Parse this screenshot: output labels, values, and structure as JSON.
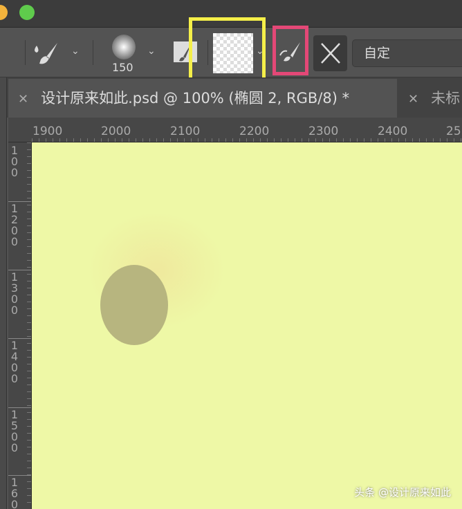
{
  "window": {
    "traffic_lights": [
      "#f3b33c",
      "#5fcb4c"
    ]
  },
  "options_bar": {
    "brush_size": "150",
    "preset_dropdown": "自定"
  },
  "tabs": [
    {
      "label": "设计原来如此.psd @ 100% (椭圆 2, RGB/8) *",
      "active": true
    },
    {
      "label": "未标",
      "active": false
    }
  ],
  "ruler_h": [
    "1900",
    "2000",
    "2100",
    "2200",
    "2300",
    "2400",
    "25"
  ],
  "ruler_v": [
    [
      "1",
      "0",
      "0"
    ],
    [
      "1",
      "2",
      "0",
      "0"
    ],
    [
      "1",
      "3",
      "0",
      "0"
    ],
    [
      "1",
      "4",
      "0",
      "0"
    ],
    [
      "1",
      "5",
      "0",
      "0"
    ],
    [
      "1",
      "6",
      "0"
    ]
  ],
  "canvas": {
    "background": "#eef8a6",
    "ellipse_color": "#b7b57f"
  },
  "highlights": {
    "yellow": "#f5ef49",
    "pink": "#e44877"
  },
  "watermark": "头条 @设计原来如此"
}
